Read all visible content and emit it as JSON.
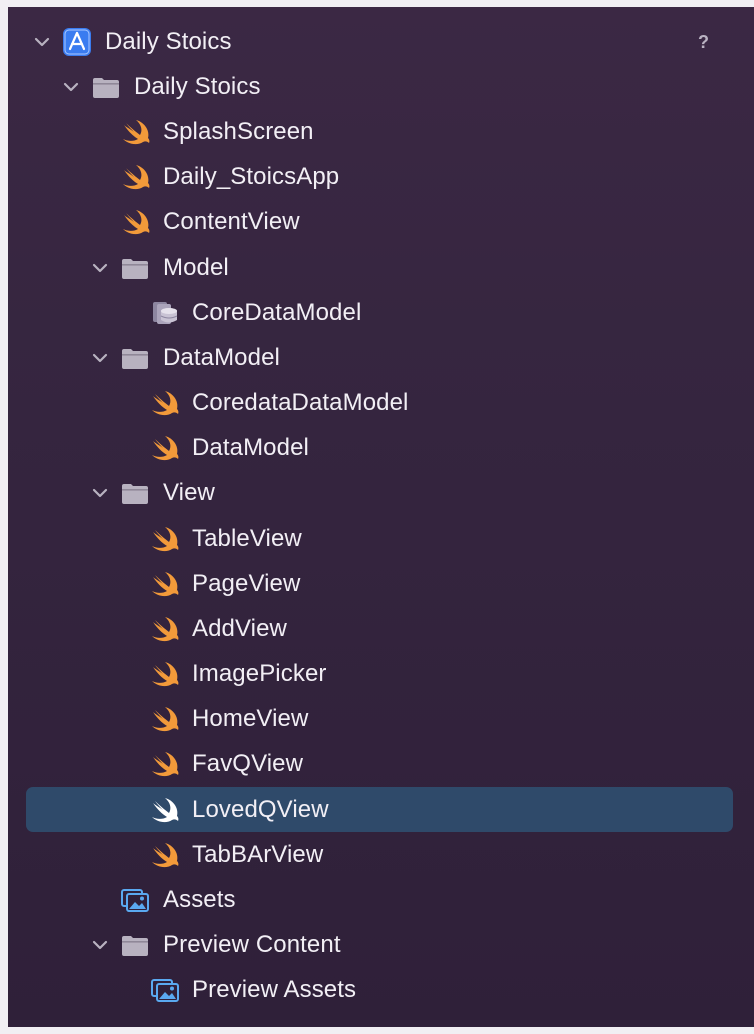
{
  "help_label": "?",
  "colors": {
    "swift": "#f29a3a",
    "selection": "#2f4a6a",
    "folder": "#b8b2c0"
  },
  "tree": [
    {
      "label": "Daily Stoics",
      "icon": "xcode-project-icon",
      "chevron": true,
      "selected": false
    },
    {
      "label": "Daily Stoics",
      "icon": "folder-icon",
      "chevron": true,
      "selected": false
    },
    {
      "label": "SplashScreen",
      "icon": "swift-file-icon",
      "chevron": false,
      "selected": false
    },
    {
      "label": "Daily_StoicsApp",
      "icon": "swift-file-icon",
      "chevron": false,
      "selected": false
    },
    {
      "label": "ContentView",
      "icon": "swift-file-icon",
      "chevron": false,
      "selected": false
    },
    {
      "label": "Model",
      "icon": "folder-icon",
      "chevron": true,
      "selected": false
    },
    {
      "label": "CoreDataModel",
      "icon": "coredata-model-icon",
      "chevron": false,
      "selected": false
    },
    {
      "label": "DataModel",
      "icon": "folder-icon",
      "chevron": true,
      "selected": false
    },
    {
      "label": "CoredataDataModel",
      "icon": "swift-file-icon",
      "chevron": false,
      "selected": false
    },
    {
      "label": "DataModel",
      "icon": "swift-file-icon",
      "chevron": false,
      "selected": false
    },
    {
      "label": "View",
      "icon": "folder-icon",
      "chevron": true,
      "selected": false
    },
    {
      "label": "TableView",
      "icon": "swift-file-icon",
      "chevron": false,
      "selected": false
    },
    {
      "label": "PageView",
      "icon": "swift-file-icon",
      "chevron": false,
      "selected": false
    },
    {
      "label": "AddView",
      "icon": "swift-file-icon",
      "chevron": false,
      "selected": false
    },
    {
      "label": "ImagePicker",
      "icon": "swift-file-icon",
      "chevron": false,
      "selected": false
    },
    {
      "label": "HomeView",
      "icon": "swift-file-icon",
      "chevron": false,
      "selected": false
    },
    {
      "label": "FavQView",
      "icon": "swift-file-icon",
      "chevron": false,
      "selected": false
    },
    {
      "label": "LovedQView",
      "icon": "swift-file-icon",
      "chevron": false,
      "selected": true
    },
    {
      "label": "TabBArView",
      "icon": "swift-file-icon",
      "chevron": false,
      "selected": false
    },
    {
      "label": "Assets",
      "icon": "asset-catalog-icon",
      "chevron": false,
      "selected": false
    },
    {
      "label": "Preview Content",
      "icon": "folder-icon",
      "chevron": true,
      "selected": false
    },
    {
      "label": "Preview Assets",
      "icon": "asset-catalog-icon",
      "chevron": false,
      "selected": false
    }
  ]
}
